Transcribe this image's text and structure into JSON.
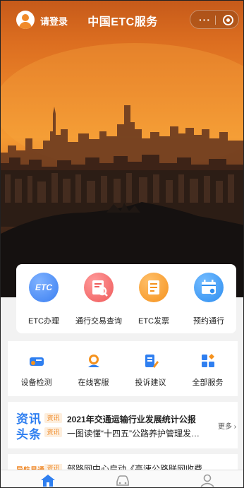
{
  "header": {
    "login_label": "请登录",
    "title": "中国ETC服务",
    "menu_dots": "···"
  },
  "main_services": [
    {
      "label": "ETC办理",
      "icon": "etc-card-icon",
      "badge_text": "ETC"
    },
    {
      "label": "通行交易查询",
      "icon": "transaction-search-icon"
    },
    {
      "label": "ETC发票",
      "icon": "invoice-icon"
    },
    {
      "label": "预约通行",
      "icon": "calendar-icon"
    }
  ],
  "secondary_services": [
    {
      "label": "设备检测",
      "icon": "device-check-icon"
    },
    {
      "label": "在线客服",
      "icon": "customer-service-icon"
    },
    {
      "label": "投诉建议",
      "icon": "complaint-icon"
    },
    {
      "label": "全部服务",
      "icon": "all-services-icon"
    }
  ],
  "news": {
    "logo_line1": "资讯",
    "logo_line2": "头条",
    "tag": "资讯",
    "items": [
      "2021年交通运输行业发展统计公报",
      "一图读懂“十四五”公路养护管理发…"
    ],
    "more_label": "更多 ›"
  },
  "news2": {
    "logo": "导航易通",
    "tag": "资讯",
    "text": "部路网中心启动《高速公路联网收费…"
  },
  "colors": {
    "accent_blue": "#2f7ff0",
    "accent_orange": "#f08a2a"
  },
  "tabbar": [
    "home-icon",
    "car-icon",
    "profile-icon"
  ]
}
